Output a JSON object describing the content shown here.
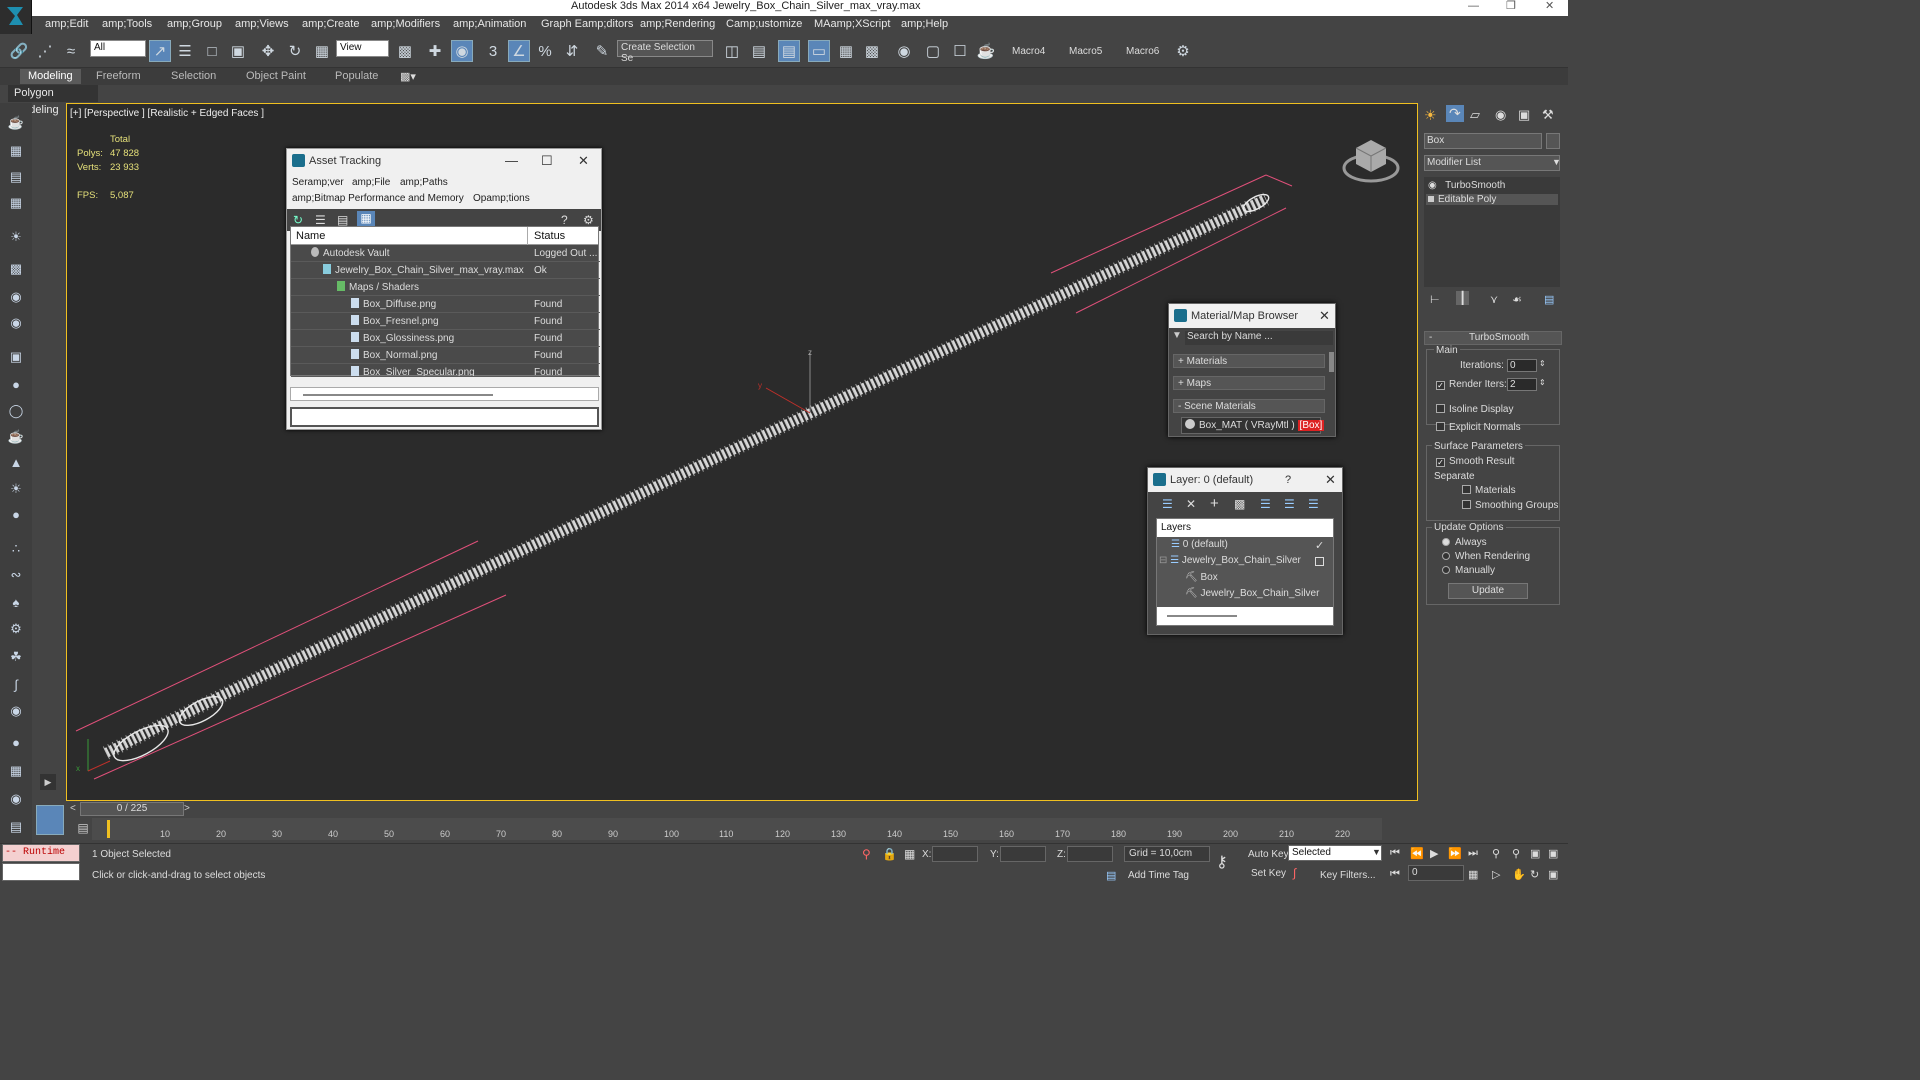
{
  "window": {
    "title": "Autodesk 3ds Max  2014 x64    Jewelry_Box_Chain_Silver_max_vray.max"
  },
  "menu": [
    "amp;Edit",
    "amp;Tools",
    "amp;Group",
    "amp;Views",
    "amp;Create",
    "amp;Modifiers",
    "amp;Animation",
    "Graph Eamp;ditors",
    "amp;Rendering",
    "Camp;ustomize",
    "MAamp;XScript",
    "amp;Help"
  ],
  "toolbar": {
    "filter_value": "All",
    "refcoord_value": "View",
    "selection_set_placeholder": "Create Selection Se",
    "macros": [
      "Macro4",
      "Macro5",
      "Macro6"
    ]
  },
  "ribbon": {
    "tabs": [
      "Modeling",
      "Freeform",
      "Selection",
      "Object Paint",
      "Populate"
    ],
    "panel": "Polygon Modeling"
  },
  "viewport": {
    "label": "[+] [Perspective ] [Realistic + Edged Faces ]",
    "stats": {
      "total_label": "Total",
      "polys_label": "Polys:",
      "polys": "47 828",
      "verts_label": "Verts:",
      "verts": "23 933",
      "fps_label": "FPS:",
      "fps": "5,087"
    },
    "axis_labels": {
      "z": "z",
      "y": "y",
      "x": "x"
    }
  },
  "asset_tracking": {
    "title": "Asset Tracking",
    "menu": [
      "Seramp;ver",
      "amp;File",
      "amp;Paths",
      "amp;Bitmap Performance and Memory",
      "Opamp;tions"
    ],
    "columns": [
      "Name",
      "Status"
    ],
    "rows": [
      {
        "name": "Autodesk Vault",
        "status": "Logged Out ..."
      },
      {
        "name": "Jewelry_Box_Chain_Silver_max_vray.max",
        "status": "Ok"
      },
      {
        "name": "Maps / Shaders",
        "status": ""
      },
      {
        "name": "Box_Diffuse.png",
        "status": "Found"
      },
      {
        "name": "Box_Fresnel.png",
        "status": "Found"
      },
      {
        "name": "Box_Glossiness.png",
        "status": "Found"
      },
      {
        "name": "Box_Normal.png",
        "status": "Found"
      },
      {
        "name": "Box_Silver_Specular.png",
        "status": "Found"
      }
    ]
  },
  "material_browser": {
    "title": "Material/Map Browser",
    "search_placeholder": "Search by Name ...",
    "groups": [
      "+ Materials",
      "+ Maps",
      "- Scene Materials"
    ],
    "item": "Box_MAT  ( VRayMtl )",
    "item_tag": "[Box]"
  },
  "layer_window": {
    "title": "Layer: 0 (default)",
    "help": "?",
    "header": "Layers",
    "items": [
      "0 (default)",
      "Jewelry_Box_Chain_Silver",
      "Box",
      "Jewelry_Box_Chain_Silver"
    ]
  },
  "command_panel": {
    "object_name": "Box",
    "modifier_list": "Modifier List",
    "stack": [
      "TurboSmooth",
      "Editable Poly"
    ],
    "rollout": "TurboSmooth",
    "main_label": "Main",
    "iterations_label": "Iterations:",
    "iterations": "0",
    "render_iters_label": "Render Iters:",
    "render_iters": "2",
    "isoline": "Isoline Display",
    "explicit_normals": "Explicit Normals",
    "surface_params": "Surface Parameters",
    "smooth_result": "Smooth Result",
    "separate": "Separate",
    "materials": "Materials",
    "smoothing_groups": "Smoothing Groups",
    "update_options": "Update Options",
    "always": "Always",
    "when_rendering": "When Rendering",
    "manually": "Manually",
    "update_button": "Update"
  },
  "timeline": {
    "frame": "0 / 225",
    "ticks": [
      "10",
      "20",
      "30",
      "40",
      "50",
      "60",
      "70",
      "80",
      "90",
      "100",
      "110",
      "120",
      "130",
      "140",
      "150",
      "160",
      "170",
      "180",
      "190",
      "200",
      "210",
      "220"
    ]
  },
  "status": {
    "maxscript": "-- Runtime e:",
    "selected": "1 Object Selected",
    "prompt": "Click or click-and-drag to select objects",
    "x_label": "X:",
    "y_label": "Y:",
    "z_label": "Z:",
    "grid": "Grid = 10,0cm",
    "add_time_tag": "Add Time Tag",
    "auto_key": "Auto Key",
    "set_key": "Set Key",
    "selected_dropdown": "Selected",
    "key_filters": "Key Filters...",
    "frame_value": "0"
  },
  "colors": {
    "accent": "#f0c020",
    "viewport_bg": "#2b2b2b",
    "stats": "#e5e07a",
    "selection_box": "#e0507a"
  }
}
